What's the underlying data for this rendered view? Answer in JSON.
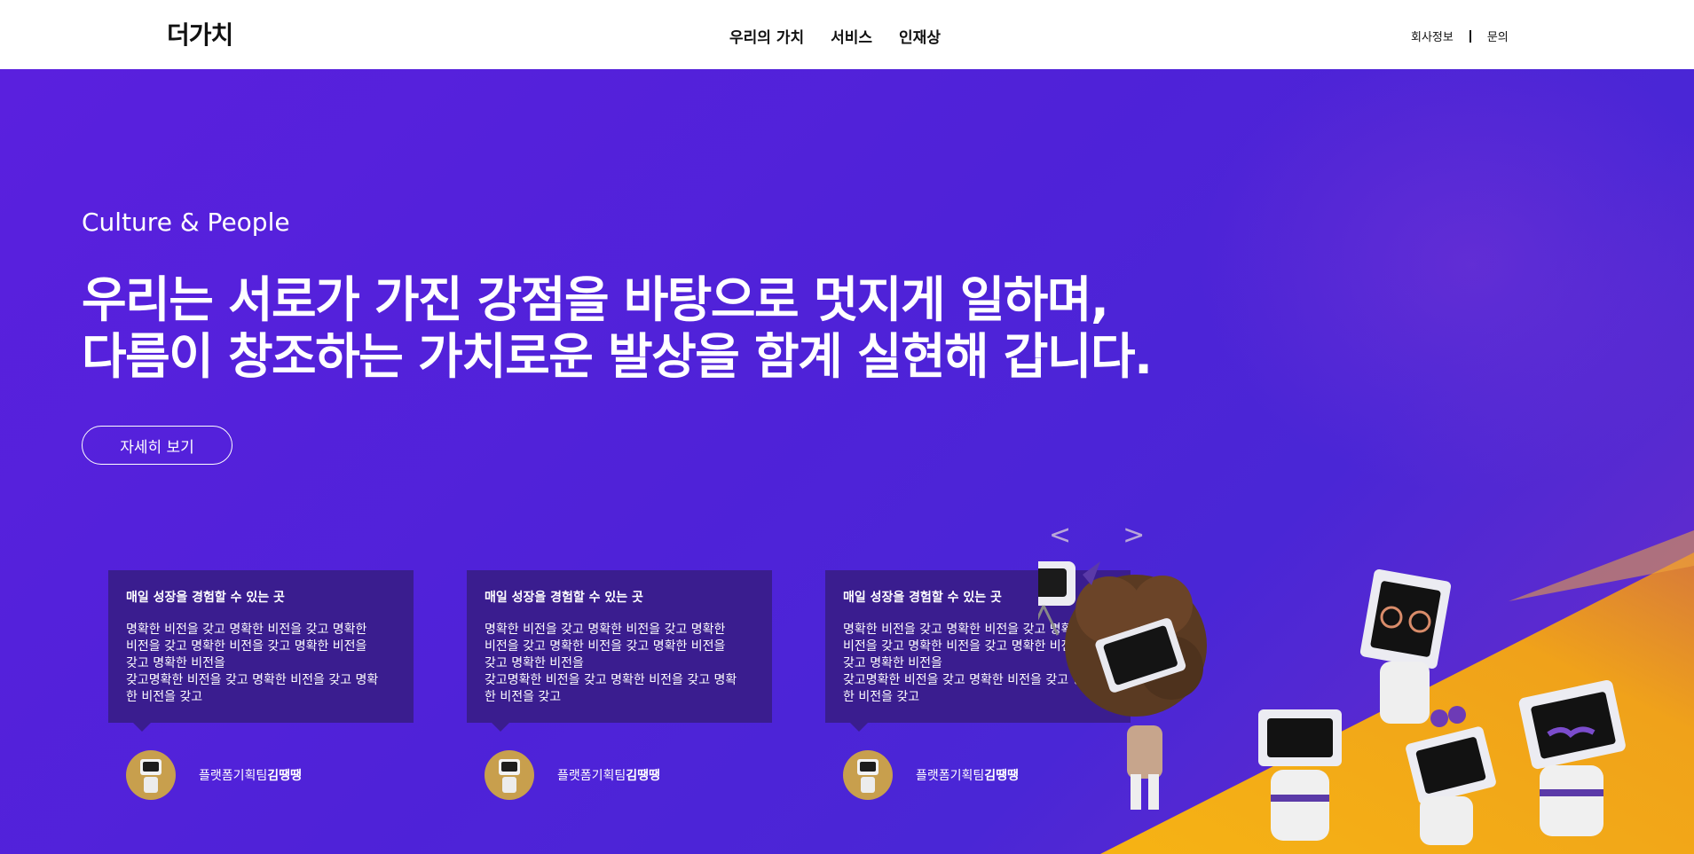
{
  "header": {
    "logo": "더가치",
    "nav": [
      "우리의 가치",
      "서비스",
      "인재상"
    ],
    "util": [
      "회사정보",
      "문의"
    ]
  },
  "hero": {
    "subtitle": "Culture & People",
    "headline": [
      "우리는 서로가 가진 강점을 바탕으로 멋지게 일하며,",
      "다름이 창조하는 가치로운 발상을 함계 실현해 갑니다."
    ],
    "cta": "자세히 보기",
    "arrows": {
      "prev": "<",
      "next": ">"
    }
  },
  "cards": [
    {
      "title": "매일 성장을 경험할 수 있는 곳",
      "lines": [
        "명확한 비전을 갖고 명확한 비전을 갖고 명확한",
        "비전을 갖고 명확한 비전을 갖고 명확한 비전을",
        "갖고 명확한 비전을",
        "갖고명확한 비전을 갖고 명확한 비전을 갖고 명확",
        "한 비전을 갖고"
      ],
      "author_team": "플랫폼기획팀",
      "author_name": "김땡땡"
    },
    {
      "title": "매일 성장을 경험할 수 있는 곳",
      "lines": [
        "명확한 비전을 갖고 명확한 비전을 갖고 명확한",
        "비전을 갖고 명확한 비전을 갖고 명확한 비전을",
        "갖고 명확한 비전을",
        "갖고명확한 비전을 갖고 명확한 비전을 갖고 명확",
        "한 비전을 갖고"
      ],
      "author_team": "플랫폼기획팀",
      "author_name": "김땡땡"
    },
    {
      "title": "매일 성장을 경험할 수 있는 곳",
      "lines": [
        "명확한 비전을 갖고 명확한 비전을 갖고 명확한",
        "비전을 갖고 명확한 비전을 갖고 명확한 비전을",
        "갖고 명확한 비전을",
        "갖고명확한 비전을 갖고 명확한 비전을 갖고 명확",
        "한 비전을 갖고"
      ],
      "author_team": "플랫폼기획팀",
      "author_name": "김땡땡"
    }
  ],
  "colors": {
    "hero_bg": "#5024d8",
    "card_bg": "#3a1d8f",
    "accent_orange": "#f0a21a",
    "avatar_bg": "#c89f4d"
  },
  "icons": [
    "chevron-left-icon",
    "chevron-right-icon",
    "robot-avatar-icon"
  ]
}
